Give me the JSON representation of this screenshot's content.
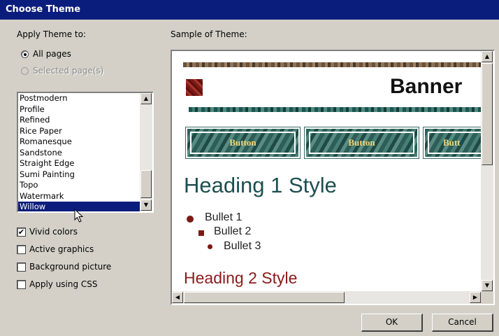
{
  "dialog": {
    "title": "Choose Theme"
  },
  "apply": {
    "label": "Apply Theme to:",
    "all_pages": "All pages",
    "selected_pages": "Selected page(s)"
  },
  "themes": {
    "items": [
      "Postmodern",
      "Profile",
      "Refined",
      "Rice Paper",
      "Romanesque",
      "Sandstone",
      "Straight Edge",
      "Sumi Painting",
      "Topo",
      "Watermark",
      "Willow"
    ],
    "selected": "Willow"
  },
  "options": {
    "vivid_colors": "Vivid colors",
    "active_graphics": "Active graphics",
    "background_picture": "Background picture",
    "apply_css": "Apply using CSS",
    "vivid_checked": true
  },
  "sample": {
    "label": "Sample of Theme:",
    "banner": "Banner",
    "button_label": "Button",
    "button_label_cut": "Butt",
    "heading1": "Heading 1 Style",
    "bullets": [
      "Bullet 1",
      "Bullet 2",
      "Bullet 3"
    ],
    "heading2": "Heading 2 Style"
  },
  "buttons": {
    "ok": "OK",
    "cancel": "Cancel"
  },
  "colors": {
    "title_bar": "#0b1d7c",
    "heading1": "#1d4f50",
    "heading2": "#8b1a1a",
    "button_text": "#f3d777"
  }
}
